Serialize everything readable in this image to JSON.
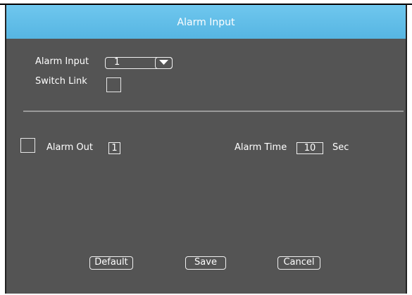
{
  "dialog": {
    "title": "Alarm Input"
  },
  "form": {
    "alarm_input_label": "Alarm Input",
    "alarm_input_value": "1",
    "switch_link_label": "Switch Link",
    "alarm_out_label": "Alarm Out",
    "alarm_out_value": "1",
    "alarm_time_label": "Alarm Time",
    "alarm_time_value": "10",
    "alarm_time_unit": "Sec"
  },
  "buttons": {
    "default_label": "Default",
    "save_label": "Save",
    "cancel_label": "Cancel"
  },
  "colors": {
    "title_bar": "#5cbbe6",
    "panel": "#545454"
  },
  "icons": {
    "dropdown": "chevron-down-icon"
  }
}
